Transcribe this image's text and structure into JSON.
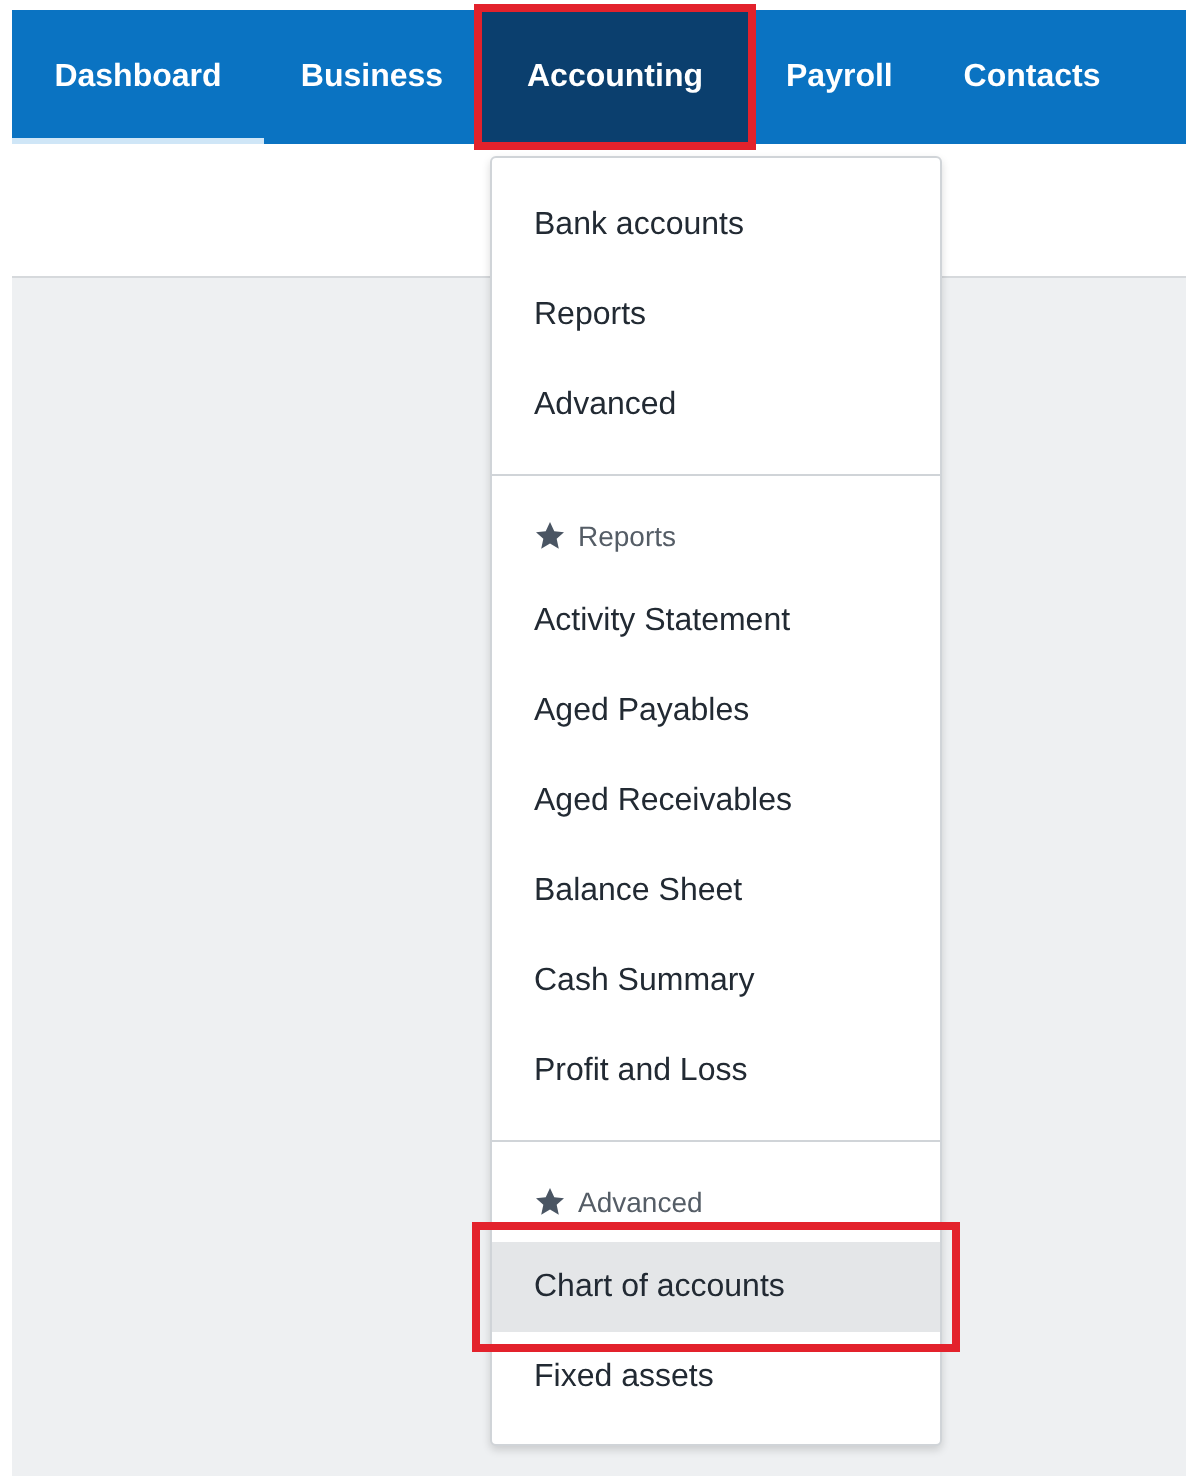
{
  "nav": [
    {
      "label": "Dashboard",
      "current": true,
      "selected": false,
      "highlighted": false
    },
    {
      "label": "Business",
      "current": false,
      "selected": false,
      "highlighted": false
    },
    {
      "label": "Accounting",
      "current": false,
      "selected": true,
      "highlighted": true
    },
    {
      "label": "Payroll",
      "current": false,
      "selected": false,
      "highlighted": false
    },
    {
      "label": "Contacts",
      "current": false,
      "selected": false,
      "highlighted": false
    }
  ],
  "menu": {
    "sections": [
      {
        "items": [
          {
            "label": "Bank accounts",
            "hovered": false,
            "highlighted": false
          },
          {
            "label": "Reports",
            "hovered": false,
            "highlighted": false
          },
          {
            "label": "Advanced",
            "hovered": false,
            "highlighted": false
          }
        ]
      },
      {
        "header": "Reports",
        "items": [
          {
            "label": "Activity Statement",
            "hovered": false,
            "highlighted": false
          },
          {
            "label": "Aged Payables",
            "hovered": false,
            "highlighted": false
          },
          {
            "label": "Aged Receivables",
            "hovered": false,
            "highlighted": false
          },
          {
            "label": "Balance Sheet",
            "hovered": false,
            "highlighted": false
          },
          {
            "label": "Cash Summary",
            "hovered": false,
            "highlighted": false
          },
          {
            "label": "Profit and Loss",
            "hovered": false,
            "highlighted": false
          }
        ]
      },
      {
        "header": "Advanced",
        "items": [
          {
            "label": "Chart of accounts",
            "hovered": true,
            "highlighted": true
          },
          {
            "label": "Fixed assets",
            "hovered": false,
            "highlighted": false
          }
        ]
      }
    ]
  }
}
